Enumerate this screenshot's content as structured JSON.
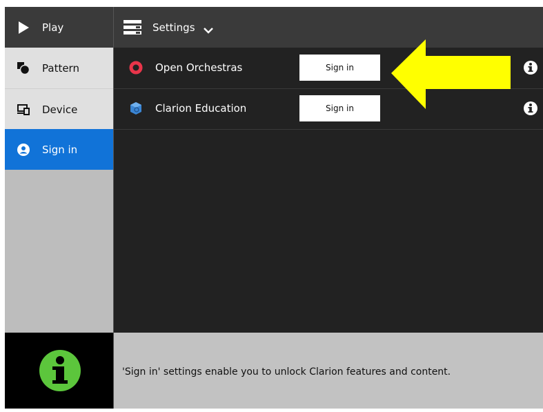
{
  "sidebar": {
    "items": [
      {
        "label": "Play",
        "icon": "play-icon"
      },
      {
        "label": "Pattern",
        "icon": "pattern-icon"
      },
      {
        "label": "Device",
        "icon": "device-icon"
      },
      {
        "label": "Sign in",
        "icon": "user-circle-icon"
      }
    ],
    "active_color": "#1173d8"
  },
  "header": {
    "title": "Settings",
    "icon": "settings-list-icon"
  },
  "providers": [
    {
      "name": "Open Orchestras",
      "button_label": "Sign in",
      "logo": "open-orchestras-logo"
    },
    {
      "name": "Clarion Education",
      "button_label": "Sign in",
      "logo": "clarion-education-logo"
    }
  ],
  "annotation": {
    "color": "#ffff00",
    "icon": "arrow-left-icon"
  },
  "footer": {
    "message": "'Sign in' settings enable you to unlock Clarion features and content.",
    "icon": "info-icon",
    "icon_color": "#5cc63c"
  }
}
